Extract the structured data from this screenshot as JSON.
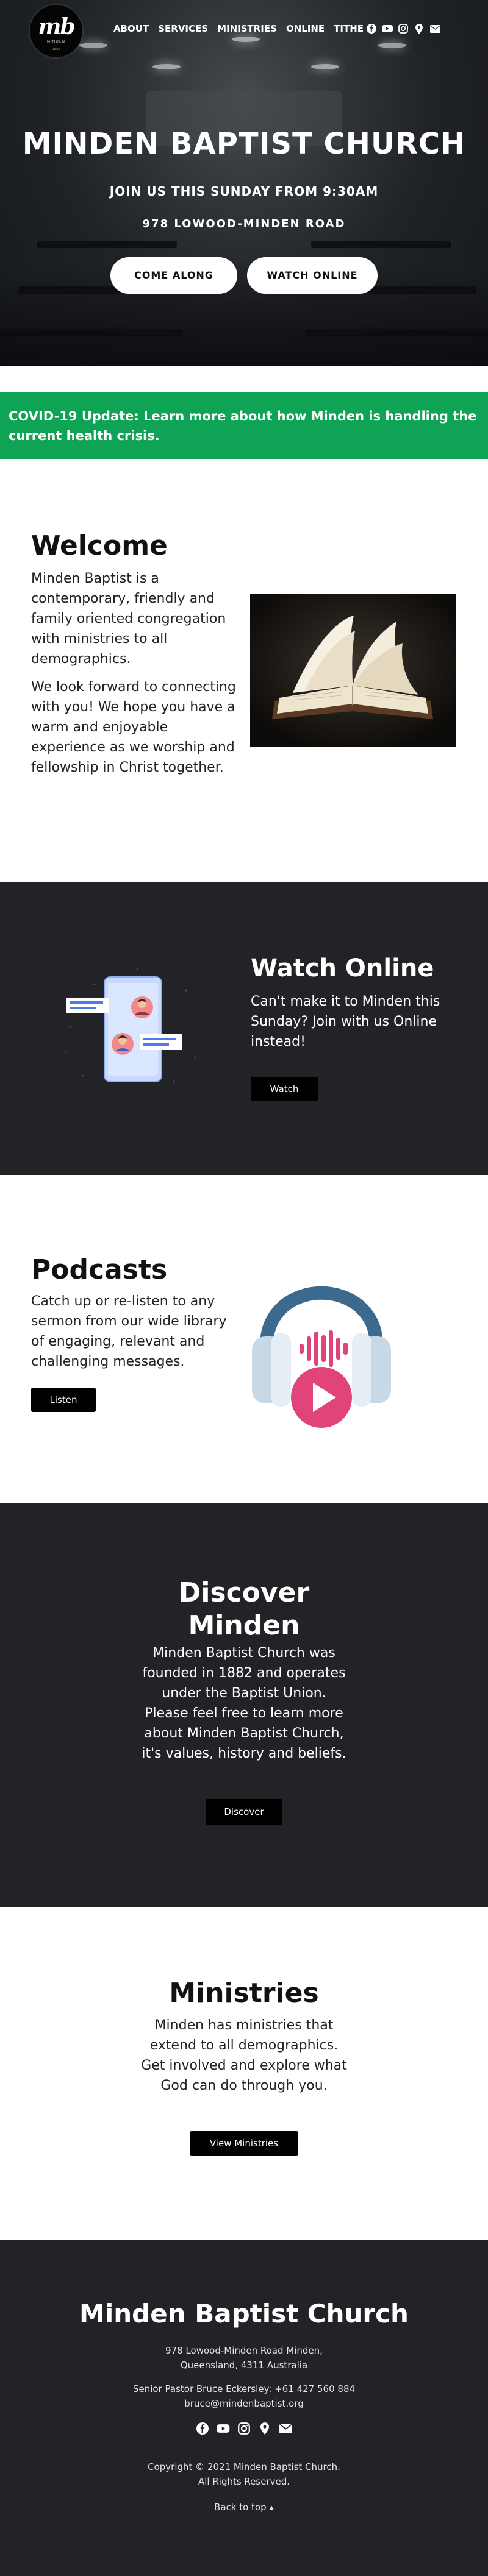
{
  "brand": {
    "logo_text": "mb",
    "logo_sub": "MINDEN",
    "logo_est": "1882"
  },
  "nav": {
    "items": [
      "ABOUT",
      "SERVICES",
      "MINISTRIES",
      "ONLINE",
      "TITHE"
    ],
    "social_icons": [
      "facebook-icon",
      "youtube-icon",
      "instagram-icon",
      "location-pin-icon",
      "mail-icon"
    ]
  },
  "hero": {
    "title": "MINDEN BAPTIST CHURCH",
    "subtitle": "JOIN US THIS SUNDAY FROM 9:30AM",
    "address": "978 LOWOOD-MINDEN ROAD",
    "buttons": [
      "COME ALONG",
      "WATCH ONLINE"
    ]
  },
  "covid": {
    "label": "COVID-19 Update:",
    "text": " Learn more about how Minden is handling the current health crisis."
  },
  "welcome": {
    "title": "Welcome",
    "p1": "Minden Baptist is a contemporary, friendly and family oriented congregation with ministries to all demographics.",
    "p2": "We look forward to connecting with you! We hope you have a warm and enjoyable experience as we worship and fellowship in Christ together."
  },
  "watch": {
    "title": "Watch Online",
    "text": "Can't make it to Minden this Sunday? Join with us Online instead!",
    "button": "Watch"
  },
  "podcasts": {
    "title": "Podcasts",
    "text": "Catch up or re-listen to any sermon from our wide library of engaging, relevant and challenging messages.",
    "button": "Listen"
  },
  "discover": {
    "title_line1": "Discover",
    "title_line2": "Minden",
    "text": "Minden Baptist Church was founded in 1882 and operates under the Baptist Union. Please feel free to learn more about Minden Baptist Church, it's values, history and beliefs.",
    "button": "Discover"
  },
  "ministries": {
    "title": "Ministries",
    "text": "Minden has ministries that extend to all demographics. Get involved and explore what God can do through you.",
    "button": "View Ministries"
  },
  "footer": {
    "title": "Minden Baptist Church",
    "address_line1": "978 Lowood-Minden Road Minden,",
    "address_line2": "Queensland, 4311 Australia",
    "pastor": "Senior Pastor Bruce Eckersley: +61 427 560 884",
    "email": "bruce@mindenbaptist.org",
    "copyright_line1": "Copyright © 2021 Minden Baptist Church.",
    "copyright_line2": "All Rights Reserved.",
    "back_to_top": "Back to top ▴",
    "social_icons": [
      "facebook-icon",
      "youtube-icon",
      "instagram-icon",
      "location-pin-icon",
      "mail-icon"
    ]
  },
  "colors": {
    "covid_green": "#0fa455",
    "dark_bg": "#212327",
    "button_black": "#000000",
    "text_dark": "#212327"
  }
}
